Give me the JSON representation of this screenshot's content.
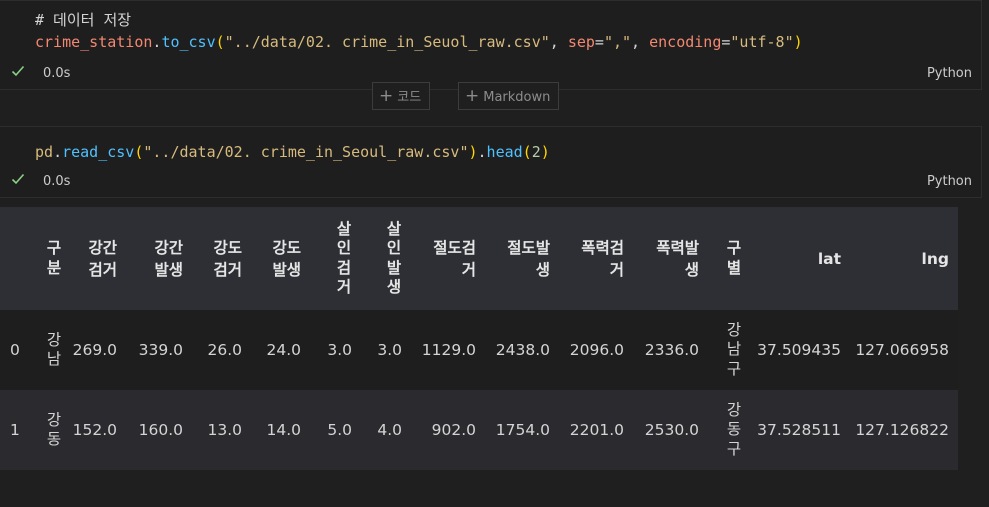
{
  "cell1": {
    "comment": "# 데이터 저장",
    "tok": {
      "var": "crime_station",
      "dot": ".",
      "fn": "to_csv",
      "open": "(",
      "path": "\"../data/02. crime_in_Seuol_raw.csv\"",
      "comma1": ", ",
      "sep_kw": "sep",
      "eq1": "=",
      "sep_val": "\",\"",
      "comma2": ", ",
      "enc_kw": "encoding",
      "eq2": "=",
      "enc_val": "\"utf-8\"",
      "close": ")"
    },
    "time": "0.0s",
    "lang": "Python"
  },
  "toolbar": {
    "code_label": "코드",
    "markdown_label": "Markdown"
  },
  "cell2": {
    "tok": {
      "pd": "pd",
      "dot": ".",
      "fn": "read_csv",
      "open": "(",
      "path": "\"../data/02. crime_in_Seoul_raw.csv\"",
      "close": ")",
      "dot2": ".",
      "head": "head",
      "open2": "(",
      "num": "2",
      "close2": ")"
    },
    "time": "0.0s",
    "lang": "Python"
  },
  "colors": {
    "success": "#89d185",
    "header_bg": "#2d2f34",
    "row_alt_bg": "#2b2b2f"
  },
  "table": {
    "columns": [
      "구분",
      "강간검거",
      "강간발생",
      "강도검거",
      "강도발생",
      "살인검거",
      "살인발생",
      "절도검거",
      "절도발생",
      "폭력검거",
      "폭력발생",
      "구별",
      "lat",
      "lng"
    ],
    "rows": [
      {
        "index": "0",
        "cells": [
          "강남",
          "269.0",
          "339.0",
          "26.0",
          "24.0",
          "3.0",
          "3.0",
          "1129.0",
          "2438.0",
          "2096.0",
          "2336.0",
          "강남구",
          "37.509435",
          "127.066958"
        ]
      },
      {
        "index": "1",
        "cells": [
          "강동",
          "152.0",
          "160.0",
          "13.0",
          "14.0",
          "5.0",
          "4.0",
          "902.0",
          "1754.0",
          "2201.0",
          "2530.0",
          "강동구",
          "37.528511",
          "127.126822"
        ]
      }
    ]
  }
}
